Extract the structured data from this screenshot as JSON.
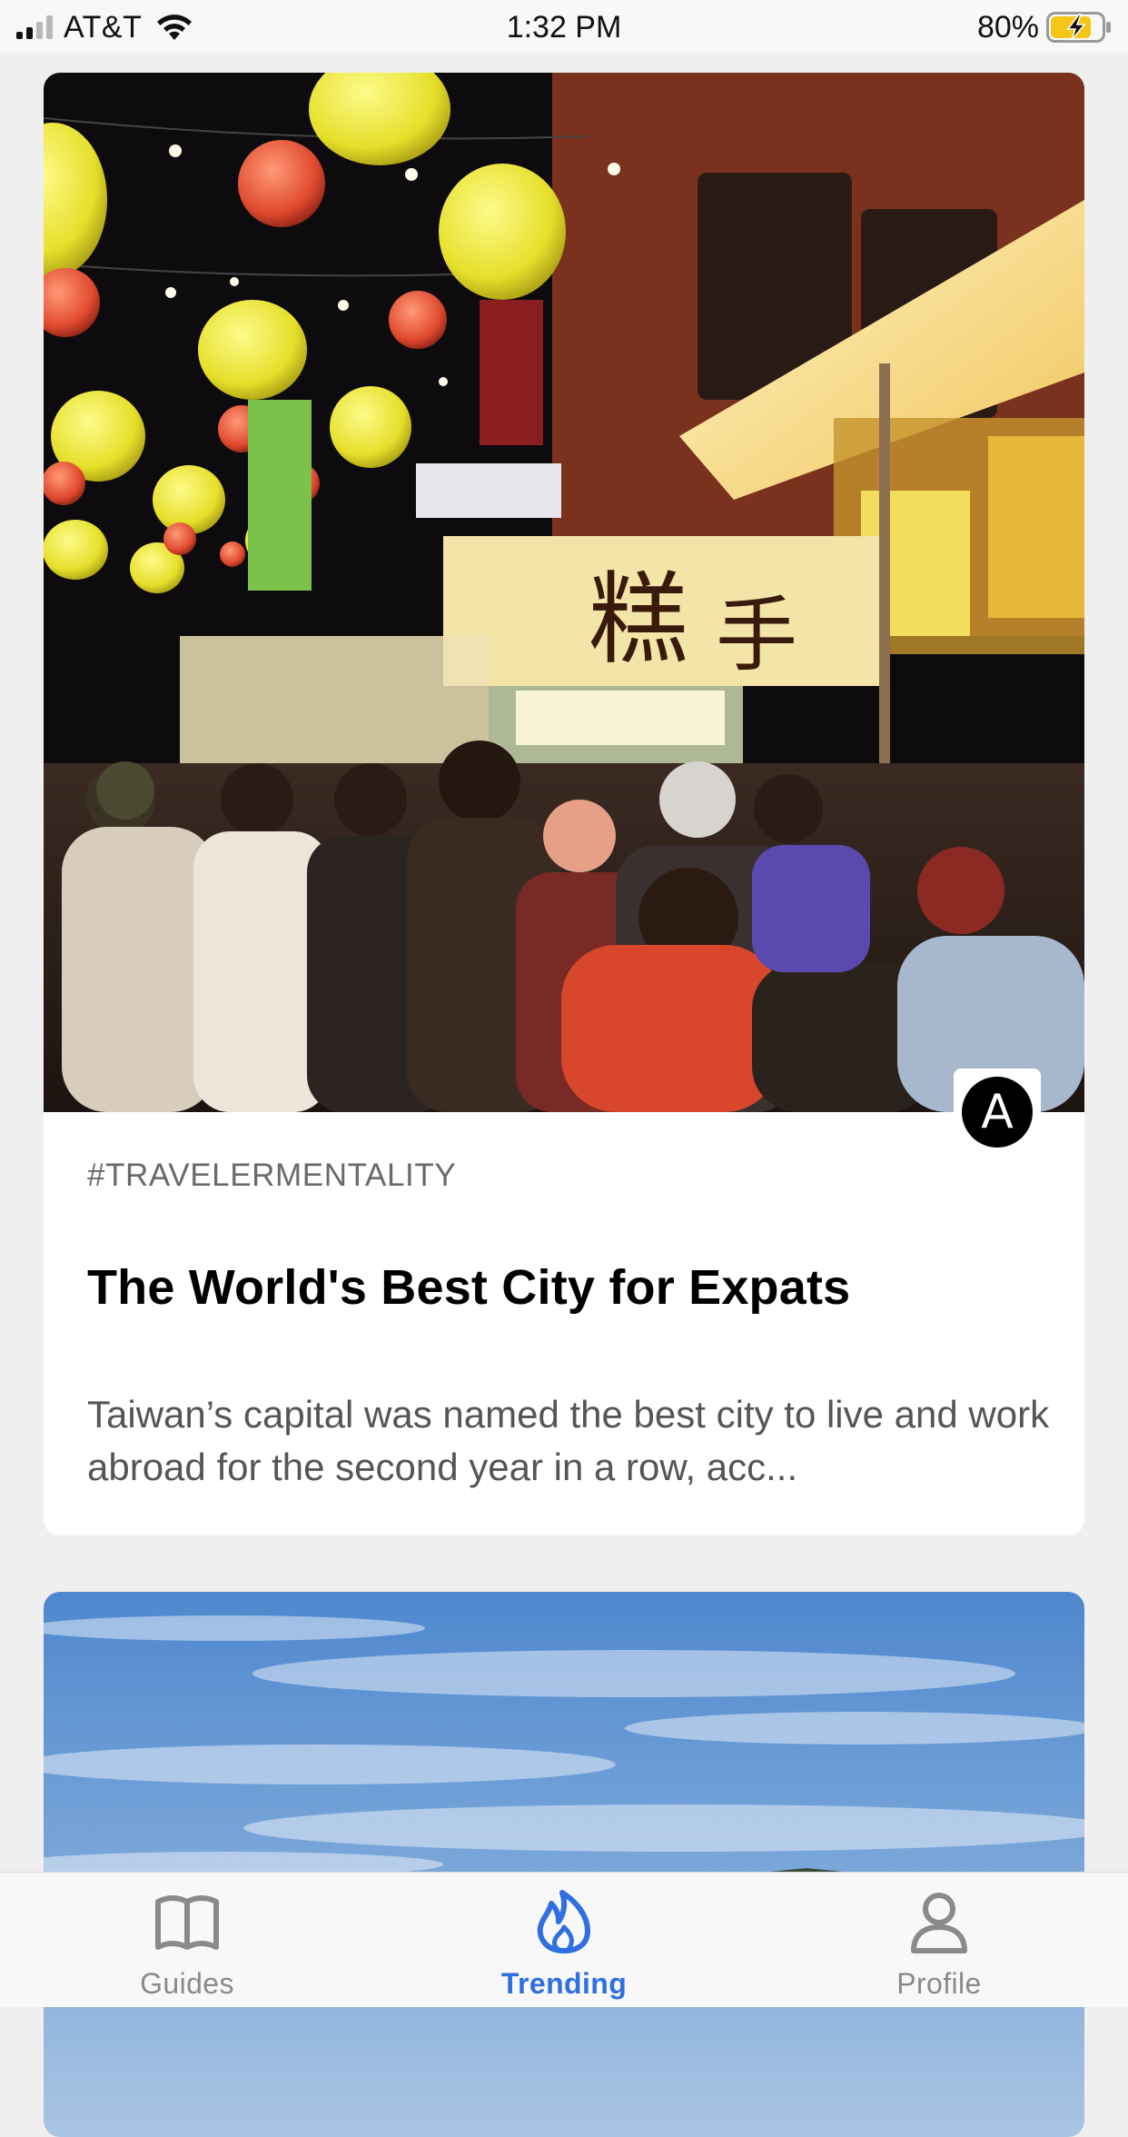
{
  "status_bar": {
    "carrier": "AT&T",
    "time": "1:32 PM",
    "battery_percent": "80%",
    "battery_level": 0.8,
    "charging": true,
    "signal_bars": 2
  },
  "feed": {
    "articles": [
      {
        "tag": "#TRAVELERMENTALITY",
        "title": "The World's Best City for Expats",
        "excerpt": " Taiwan’s capital was named the best city to live and work abroad for the second year in a row, acc...",
        "publisher_initial": "A",
        "image": "night-market-lanterns"
      },
      {
        "image": "blue-sky-landscape"
      }
    ]
  },
  "tab_bar": {
    "tabs": [
      {
        "label": "Guides",
        "icon": "book-icon",
        "active": false
      },
      {
        "label": "Trending",
        "icon": "flame-icon",
        "active": true
      },
      {
        "label": "Profile",
        "icon": "person-icon",
        "active": false
      }
    ]
  },
  "colors": {
    "accent": "#2f6fe0",
    "inactive": "#8a8a8a",
    "background": "#efefef"
  }
}
